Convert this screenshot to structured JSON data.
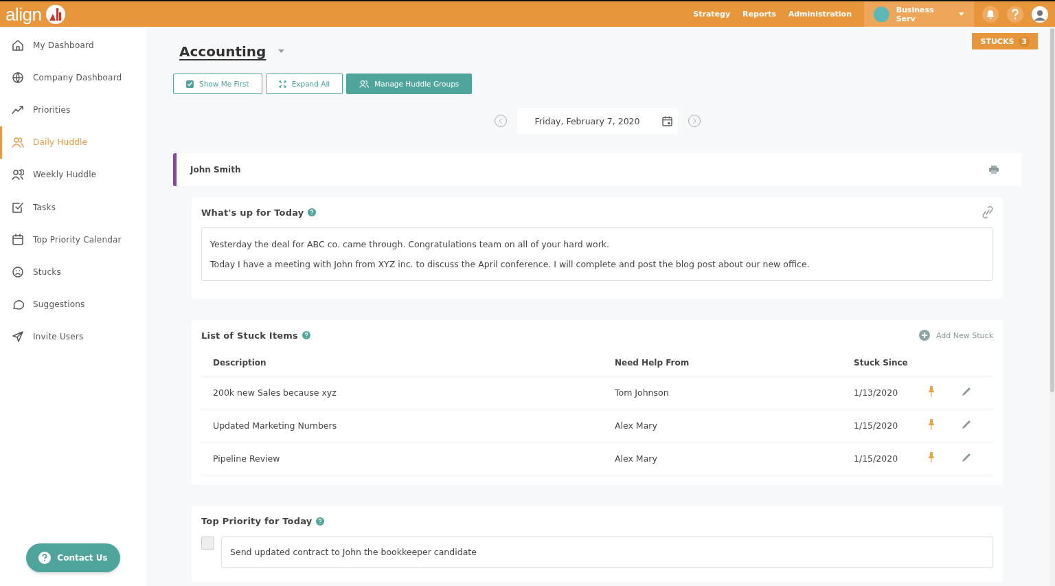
{
  "topbar": {
    "logo": "align",
    "nav": [
      "Strategy",
      "Reports",
      "Administration"
    ],
    "account": "Business Serv"
  },
  "sidebar": {
    "items": [
      {
        "label": "My Dashboard",
        "selected": false
      },
      {
        "label": "Company Dashboard",
        "selected": false
      },
      {
        "label": "Priorities",
        "selected": false
      },
      {
        "label": "Daily Huddle",
        "selected": true
      },
      {
        "label": "Weekly Huddle",
        "selected": false
      },
      {
        "label": "Tasks",
        "selected": false
      },
      {
        "label": "Top Priority Calendar",
        "selected": false
      },
      {
        "label": "Stucks",
        "selected": false
      },
      {
        "label": "Suggestions",
        "selected": false
      },
      {
        "label": "Invite Users",
        "selected": false
      }
    ],
    "contact": "Contact Us"
  },
  "page": {
    "title": "Accounting",
    "stucks_badge": {
      "label": "STUCKS",
      "count": "3"
    },
    "buttons": [
      {
        "label": "Show Me First",
        "kind": "outline"
      },
      {
        "label": "Expand All",
        "kind": "outline"
      },
      {
        "label": "Manage Huddle Groups",
        "kind": "filled"
      }
    ],
    "date": "Friday, February 7, 2020"
  },
  "member": {
    "name": "John Smith",
    "whats_up": {
      "title": "What's up for Today",
      "lines": [
        "Yesterday the deal for ABC co. came through. Congratulations team on all of your hard work.",
        "Today I have a meeting with John from XYZ inc. to discuss the April conference. I will complete and post the blog post about our new office."
      ]
    },
    "stucks": {
      "title": "List of Stuck Items",
      "add": "Add New Stuck",
      "columns": [
        "Description",
        "Need Help From",
        "Stuck Since"
      ],
      "rows": [
        {
          "description": "200k new Sales because xyz",
          "help_from": "Tom Johnson",
          "since": "1/13/2020"
        },
        {
          "description": "Updated Marketing Numbers",
          "help_from": "Alex Mary",
          "since": "1/15/2020"
        },
        {
          "description": "Pipeline Review",
          "help_from": "Alex Mary",
          "since": "1/15/2020"
        }
      ]
    },
    "top_priority": {
      "title": "Top Priority for Today",
      "items": [
        {
          "text": "Send updated contract to John the bookkeeper candidate",
          "checked": false
        }
      ]
    }
  }
}
